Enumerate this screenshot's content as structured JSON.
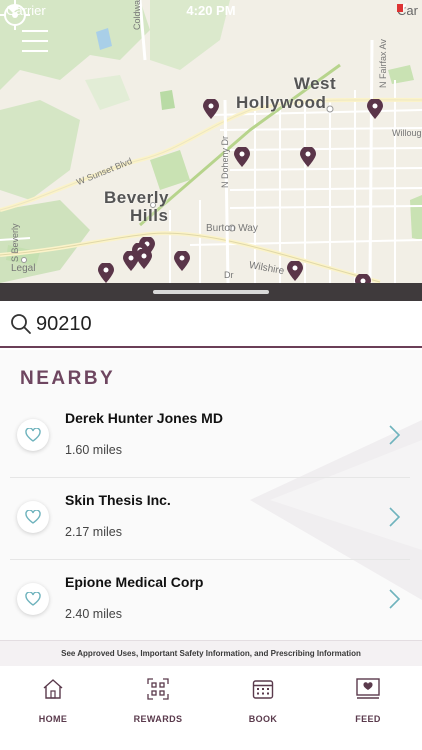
{
  "status_bar": {
    "carrier_left": "Carrier",
    "time": "4:20 PM",
    "carrier_right": "Car"
  },
  "map": {
    "labels": {
      "west_hollywood": "West\nHollywood",
      "beverly_hills": "Beverly\nHills",
      "coldwater": "Coldwater Ca",
      "sunset": "W Sunset Blvd",
      "doheny": "N Doheny Dr",
      "burton": "Burton Way",
      "wilshire": "Wilshire",
      "fairfax": "N Fairfax Av",
      "willough": "Willoug",
      "s_beverly": "S Beverly",
      "legal": "Legal",
      "dr": "Dr"
    },
    "pin_color": "#5a3549"
  },
  "search": {
    "value": "90210"
  },
  "nearby": {
    "heading": "NEARBY",
    "results": [
      {
        "name": "Derek Hunter Jones MD",
        "distance": "1.60 miles"
      },
      {
        "name": "Skin Thesis Inc.",
        "distance": "2.17 miles"
      },
      {
        "name": "Epione Medical Corp",
        "distance": "2.40 miles"
      }
    ]
  },
  "disclaimer": "See Approved Uses, Important Safety Information, and Prescribing Information",
  "tabs": [
    {
      "label": "HOME",
      "icon": "home-icon"
    },
    {
      "label": "REWARDS",
      "icon": "qr-code-icon"
    },
    {
      "label": "BOOK",
      "icon": "calendar-icon"
    },
    {
      "label": "FEED",
      "icon": "feed-icon"
    }
  ],
  "colors": {
    "accent": "#6e4660",
    "teal": "#6fb3bd",
    "bar": "#3f3a3c"
  }
}
